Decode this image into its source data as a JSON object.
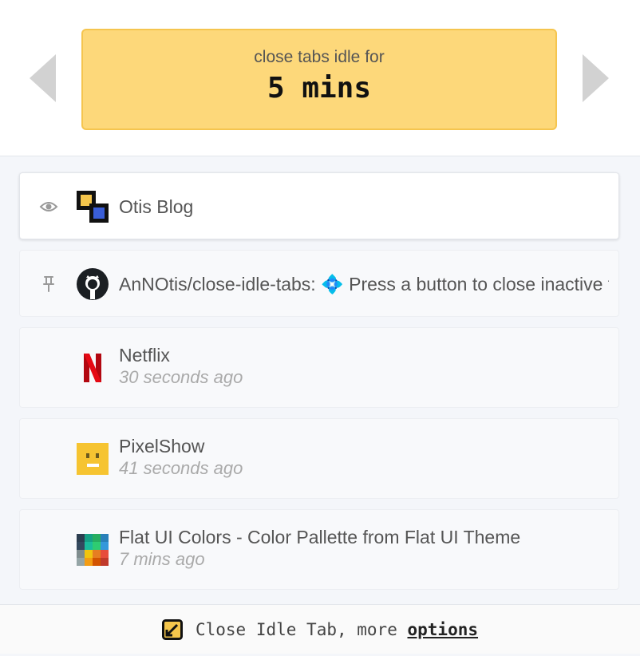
{
  "header": {
    "label": "close tabs idle for",
    "value": "5 mins",
    "prev_icon": "triangle-left-icon",
    "next_icon": "triangle-right-icon"
  },
  "tabs": [
    {
      "title": "Otis Blog",
      "time": "",
      "state_icon": "eye-icon",
      "favicon": "otis-blog-favicon",
      "active": true
    },
    {
      "title": "AnNOtis/close-idle-tabs: 💠 Press a button to close inactive tabs",
      "time": "",
      "state_icon": "pin-icon",
      "favicon": "github-favicon",
      "active": false
    },
    {
      "title": "Netflix",
      "time": "30 seconds ago",
      "favicon": "netflix-favicon",
      "active": false
    },
    {
      "title": "PixelShow",
      "time": "41 seconds ago",
      "favicon": "pixelshow-favicon",
      "active": false
    },
    {
      "title": "Flat UI Colors - Color Pallette from Flat UI Theme",
      "time": "7 mins ago",
      "favicon": "flat-ui-colors-favicon",
      "active": false
    }
  ],
  "footer": {
    "label": "Close Idle Tab, more ",
    "link": "options",
    "icon": "pencil-square-icon"
  },
  "colors": {
    "timer_bg": "#fdd87a",
    "timer_border": "#f5c54f",
    "arrow": "#d2d2d2",
    "time_text": "#aaaaaa"
  }
}
